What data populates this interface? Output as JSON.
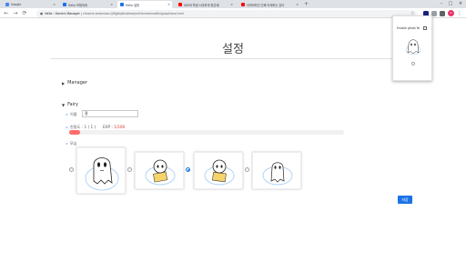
{
  "browser": {
    "tabs": [
      {
        "label": "Google",
        "favicon_color": "#4285f4"
      },
      {
        "label": "Hello 모험세계",
        "favicon_color": "#1a73e8"
      },
      {
        "label": "Hello 설정",
        "favicon_color": "#1a73e8"
      },
      {
        "label": "요요와 학생 서쿠하게 좋은데!",
        "favicon_color": "#ff0000"
      },
      {
        "label": "아따하하인 진짜 아케하는 강아",
        "favicon_color": "#ff0000"
      }
    ],
    "tab_close_glyph": "×",
    "new_tab_glyph": "+",
    "window_controls": [
      "–",
      "□",
      "×"
    ],
    "nav": {
      "back": "←",
      "forward": "→",
      "reload": "⟳"
    },
    "address_host": "Hello : Gemini Manager",
    "address_path": "chrome-extension://ffgjlkjdkcbhaejnnfnbnmmnoafkcjp/options.html",
    "avatar_initial": "G"
  },
  "page": {
    "title": "설정",
    "manager_section": "Manager",
    "fairy_section": "Fairy",
    "name_label": "이름",
    "name_value": "잘",
    "affinity_label": "친밀도 : 1 ( 1 )",
    "exp_label": "EXP :",
    "exp_value": "1/100",
    "exp_fraction": 0.01,
    "image_label": "모습",
    "selected_image_index": 2,
    "save_label": "저장"
  },
  "popup": {
    "label": "Enable ghost Ni"
  },
  "colors": {
    "accent": "#1a73e8",
    "progress": "#ff6b6b",
    "exp_value": "#d93025"
  },
  "icons": [
    "lock-icon",
    "star-icon",
    "puzzle-icon",
    "kebab-menu-icon",
    "ghost-icon",
    "caret-right-icon",
    "caret-down-icon"
  ]
}
